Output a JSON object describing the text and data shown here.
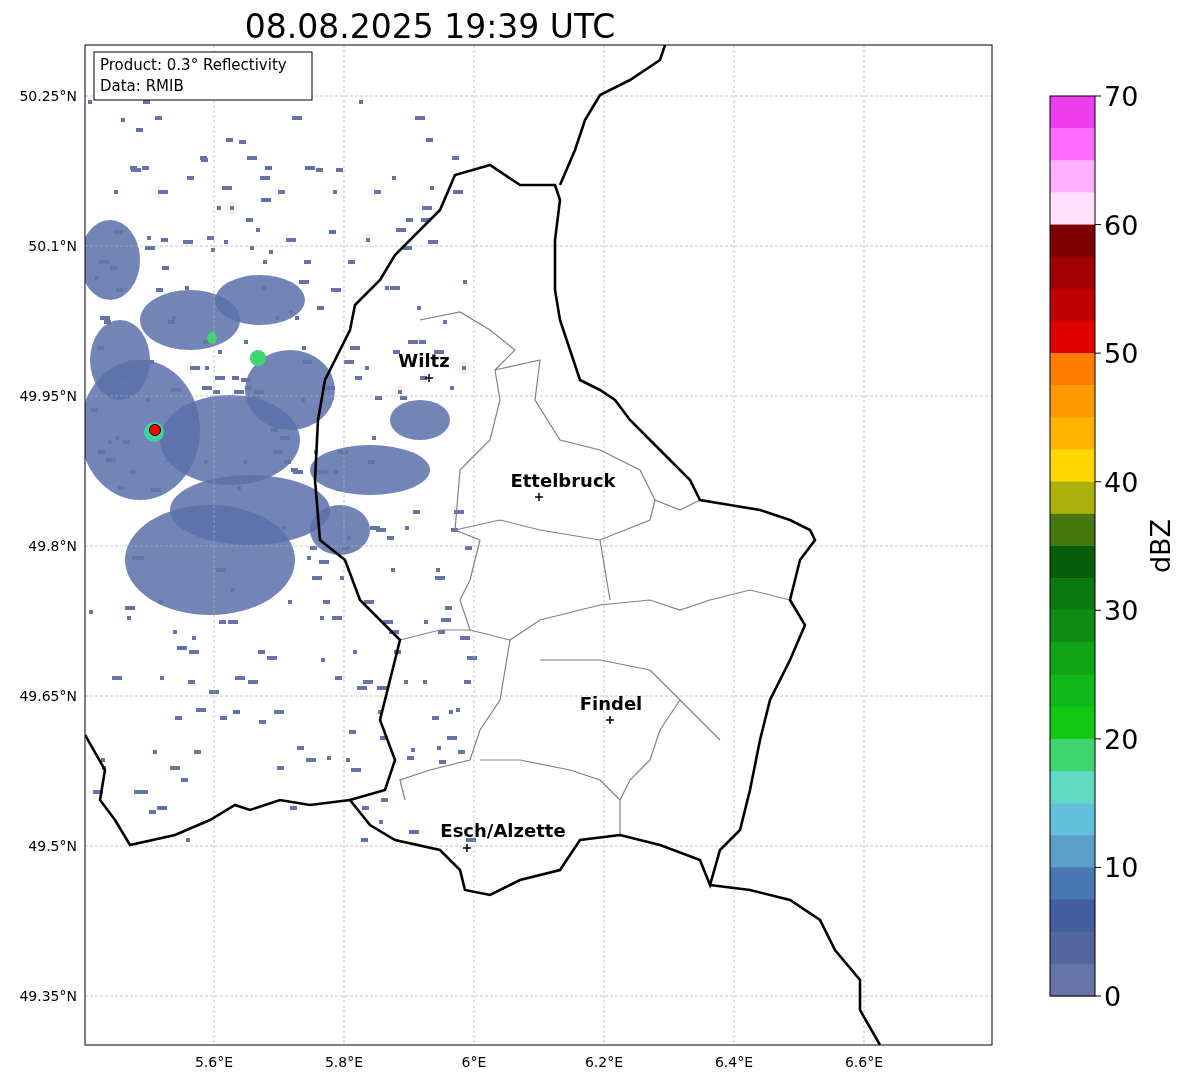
{
  "title": "08.08.2025 19:39 UTC",
  "info": [
    "Product: 0.3° Reflectivity",
    "Data: RMIB"
  ],
  "map": {
    "x_ticks": [
      "5.6°E",
      "5.8°E",
      "6°E",
      "6.2°E",
      "6.4°E",
      "6.6°E"
    ],
    "y_ticks": [
      "50.25°N",
      "50.1°N",
      "49.95°N",
      "49.8°N",
      "49.65°N",
      "49.5°N",
      "49.35°N"
    ],
    "cities": [
      {
        "name": "Wiltz"
      },
      {
        "name": "Ettelbruck"
      },
      {
        "name": "Findel"
      },
      {
        "name": "Esch/Alzette"
      }
    ]
  },
  "colorbar": {
    "label": "dBZ",
    "ticks": [
      "70",
      "60",
      "50",
      "40",
      "30",
      "20",
      "10",
      "0"
    ],
    "bins": [
      {
        "color": "#ee3cee"
      },
      {
        "color": "#ff6cff"
      },
      {
        "color": "#ffb0ff"
      },
      {
        "color": "#ffe0ff"
      },
      {
        "color": "#7c0000"
      },
      {
        "color": "#a00000"
      },
      {
        "color": "#c00000"
      },
      {
        "color": "#e00000"
      },
      {
        "color": "#ff7d00"
      },
      {
        "color": "#ff9a00"
      },
      {
        "color": "#ffb400"
      },
      {
        "color": "#ffd700"
      },
      {
        "color": "#adb00a"
      },
      {
        "color": "#46780e"
      },
      {
        "color": "#075e0a"
      },
      {
        "color": "#0b7810"
      },
      {
        "color": "#0e8c12"
      },
      {
        "color": "#10a416"
      },
      {
        "color": "#10b81a"
      },
      {
        "color": "#12c812"
      },
      {
        "color": "#3ed46e"
      },
      {
        "color": "#5fd8c4"
      },
      {
        "color": "#63c0dc"
      },
      {
        "color": "#5a9fc8"
      },
      {
        "color": "#4a78b2"
      },
      {
        "color": "#435e9e"
      },
      {
        "color": "#53659f"
      },
      {
        "color": "#6474a6"
      }
    ]
  }
}
